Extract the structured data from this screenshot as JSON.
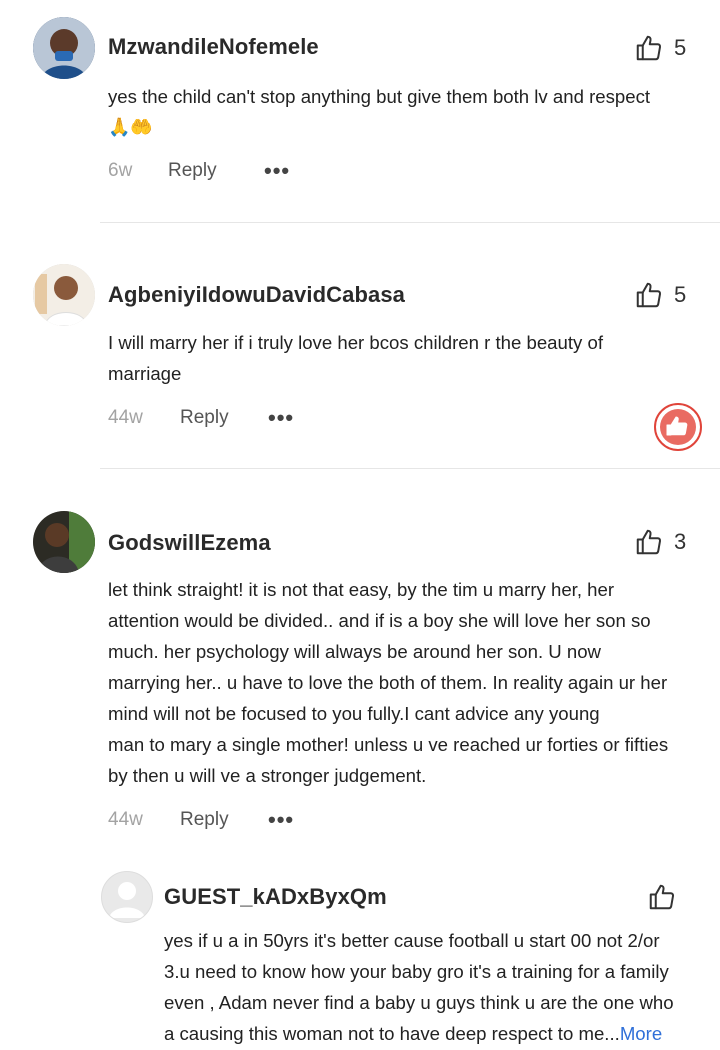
{
  "comments": [
    {
      "username": "MzwandileNofemele",
      "likes": "5",
      "lines": [
        "yes the child can't stop anything but give them both lv and respect"
      ],
      "emoji": "🙏🤲",
      "time": "6w",
      "reply_label": "Reply",
      "more_label": "•••"
    },
    {
      "username": "AgbeniyiIdowuDavidCabasa",
      "likes": "5",
      "lines": [
        "I will marry her if i truly love her bcos children r the beauty of",
        "marriage"
      ],
      "time": "44w",
      "reply_label": "Reply",
      "more_label": "•••"
    },
    {
      "username": "GodswillEzema",
      "likes": "3",
      "lines": [
        "let think straight! it is not that easy, by the tim u marry her, her",
        "attention would be divided.. and if is a boy she will love her son so",
        "much. her psychology will always be around her son. U now",
        "marrying her.. u have to love the both of them. In reality again ur her",
        "mind will not be focused to you fully.I cant advice any young",
        "man to mary a single mother! unless u ve reached ur forties or fifties",
        "by then u will ve a stronger judgement."
      ],
      "time": "44w",
      "reply_label": "Reply",
      "more_label": "•••"
    }
  ],
  "reply": {
    "username": "GUEST_kADxByxQm",
    "lines": [
      "yes if u a in 50yrs it's better cause football u start 00 not 2/or",
      "3.u need to know how your baby gro it's a training for a family",
      "even , Adam never find a baby u guys think u are the one who",
      "a causing this woman not to have deep respect to me..."
    ],
    "more_link": "More"
  },
  "colors": {
    "accent_link": "#2f6fd8",
    "badge_red": "#e0443a",
    "divider": "#e6e6e6"
  },
  "icons": {
    "like": "thumbs-up-icon",
    "badge": "thumbs-up-badge-icon",
    "default_avatar": "user-placeholder-icon"
  }
}
